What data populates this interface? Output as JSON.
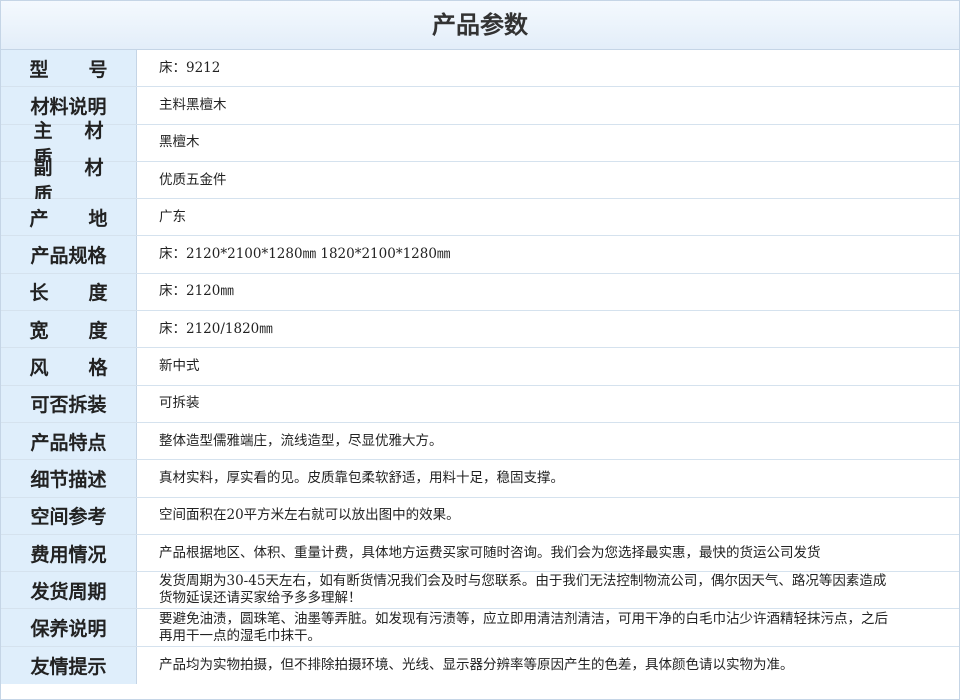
{
  "title": "产品参数",
  "rows": [
    {
      "label": "型 号",
      "style": "spread2",
      "value": "床：9212"
    },
    {
      "label": "材料说明",
      "style": "normal",
      "value": "主料黑檀木"
    },
    {
      "label": "主材质",
      "style": "spread3",
      "value": "黑檀木"
    },
    {
      "label": "副材质",
      "style": "spread3",
      "value": "优质五金件"
    },
    {
      "label": "产 地",
      "style": "spread2",
      "value": "广东"
    },
    {
      "label": "产品规格",
      "style": "normal",
      "value": "床：2120*2100*1280㎜  1820*2100*1280㎜"
    },
    {
      "label": "长 度",
      "style": "spread2",
      "value": "床：2120㎜"
    },
    {
      "label": "宽 度",
      "style": "spread2",
      "value": "床：2120/1820㎜"
    },
    {
      "label": "风 格",
      "style": "spread2",
      "value": "新中式"
    },
    {
      "label": "可否拆装",
      "style": "normal",
      "value": "可拆装"
    },
    {
      "label": "产品特点",
      "style": "normal",
      "value": "整体造型儒雅端庄，流线造型，尽显优雅大方。"
    },
    {
      "label": "细节描述",
      "style": "normal",
      "value": "真材实料，厚实看的见。皮质靠包柔软舒适，用料十足，稳固支撑。"
    },
    {
      "label": "空间参考",
      "style": "normal",
      "value": "空间面积在20平方米左右就可以放出图中的效果。"
    },
    {
      "label": "费用情况",
      "style": "normal",
      "value": "产品根据地区、体积、重量计费，具体地方运费买家可随时咨询。我们会为您选择最实惠，最快的货运公司发货"
    },
    {
      "label": "发货周期",
      "style": "normal",
      "value": "发货周期为30-45天左右，如有断货情况我们会及时与您联系。由于我们无法控制物流公司，偶尔因天气、路况等因素造成货物延误还请买家给予多多理解！"
    },
    {
      "label": "保养说明",
      "style": "normal",
      "value": "要避免油渍，圆珠笔、油墨等弄脏。如发现有污渍等，应立即用清洁剂清洁，可用干净的白毛巾沾少许酒精轻抹污点，之后再用干一点的湿毛巾抹干。"
    },
    {
      "label": "友情提示",
      "style": "normal",
      "value": "产品均为实物拍摄，但不排除拍摄环境、光线、显示器分辨率等原因产生的色差，具体颜色请以实物为准。"
    }
  ]
}
